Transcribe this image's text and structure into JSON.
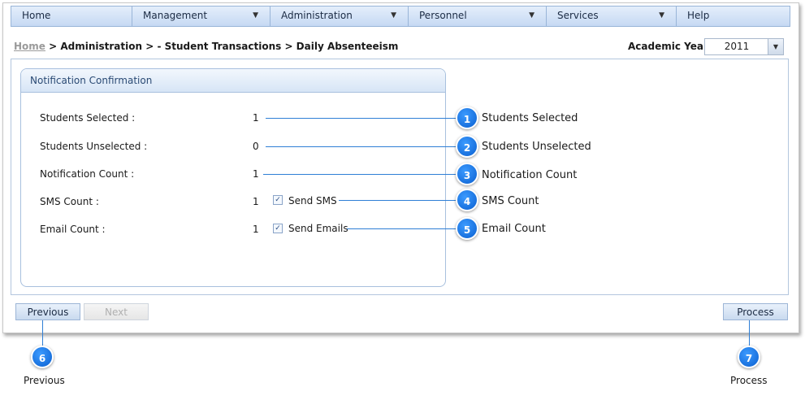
{
  "menu": [
    {
      "label": "Home",
      "dropdown": false
    },
    {
      "label": "Management",
      "dropdown": true
    },
    {
      "label": "Administration",
      "dropdown": true
    },
    {
      "label": "Personnel",
      "dropdown": true
    },
    {
      "label": "Services",
      "dropdown": true
    },
    {
      "label": "Help",
      "dropdown": false
    }
  ],
  "breadcrumb": {
    "home": "Home",
    "path": " > Administration > - Student Transactions > Daily Absenteeism"
  },
  "academic_year": {
    "label": "Academic Year",
    "value": "2011"
  },
  "panel": {
    "title": "Notification Confirmation",
    "rows": [
      {
        "label": "Students Selected :",
        "value": "1"
      },
      {
        "label": "Students Unselected :",
        "value": "0"
      },
      {
        "label": "Notification Count :",
        "value": "1"
      },
      {
        "label": "SMS Count :",
        "value": "1",
        "checkbox": "Send SMS",
        "checked": true
      },
      {
        "label": "Email Count :",
        "value": "1",
        "checkbox": "Send Emails",
        "checked": true
      }
    ]
  },
  "callouts": [
    {
      "num": "1",
      "text": "Students Selected"
    },
    {
      "num": "2",
      "text": "Students Unselected"
    },
    {
      "num": "3",
      "text": "Notification Count"
    },
    {
      "num": "4",
      "text": "SMS Count"
    },
    {
      "num": "5",
      "text": "Email Count"
    },
    {
      "num": "6",
      "text": "Previous"
    },
    {
      "num": "7",
      "text": "Process"
    }
  ],
  "buttons": {
    "previous": "Previous",
    "next": "Next",
    "process": "Process"
  },
  "colors": {
    "accent": "#0a5fd0",
    "menu_bg": "#c6d9f3",
    "panel_border": "#a8c0de"
  }
}
